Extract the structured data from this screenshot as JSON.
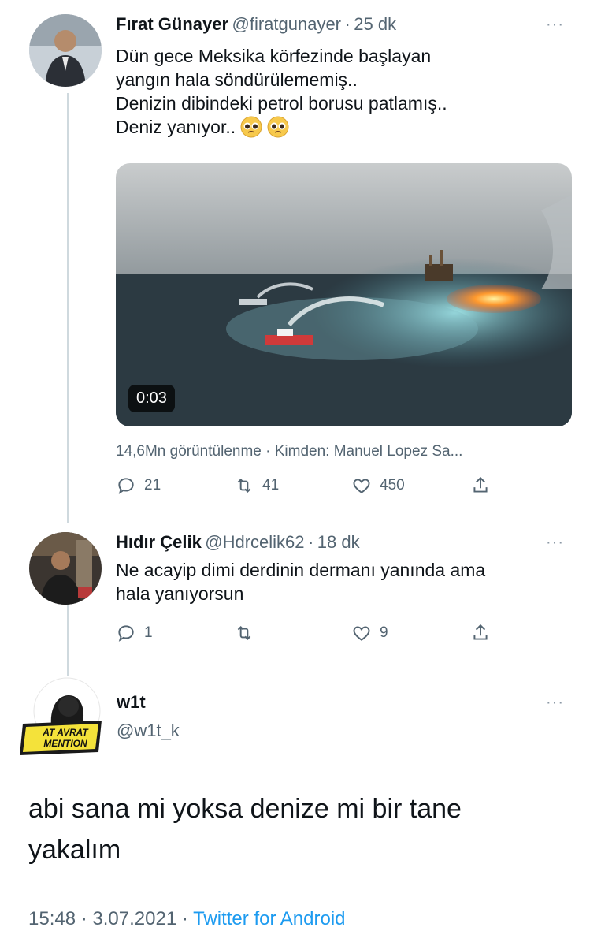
{
  "tweet1": {
    "name": "Fırat Günayer",
    "handle": "@firatgunayer",
    "sep": "·",
    "time": "25 dk",
    "lines": [
      "Dün gece Meksika körfezinde başlayan",
      "yangın hala söndürülememiş..",
      "Denizin dibindeki petrol borusu patlamış..",
      "Deniz yanıyor.."
    ],
    "emoji": "pleading-face-icon",
    "video": {
      "duration": "0:03"
    },
    "views_line": "14,6Mn görüntülenme · Kimden: Manuel Lopez Sa...",
    "actions": {
      "reply": "21",
      "retweet": "41",
      "like": "450"
    }
  },
  "tweet2": {
    "name": "Hıdır Çelik",
    "handle": "@Hdrcelik62",
    "sep": "·",
    "time": "18 dk",
    "lines": [
      "Ne acayip dimi derdinin dermanı yanında ama",
      "hala yanıyorsun"
    ],
    "actions": {
      "reply": "1",
      "retweet": "",
      "like": "9"
    }
  },
  "tweet3": {
    "name": "w1t",
    "handle": "@w1t_k",
    "avatar_logo": "AT AVRAT MENTION",
    "lines": [
      "abi sana mi yoksa denize mi bir tane",
      "yakalım"
    ],
    "footer": {
      "time": "15:48",
      "sep1": "·",
      "date": "3.07.2021",
      "sep2": "·",
      "source": "Twitter for Android"
    }
  },
  "more_label": "···",
  "colors": {
    "link": "#1d9bf0",
    "muted": "#536471",
    "text": "#0f1419"
  }
}
